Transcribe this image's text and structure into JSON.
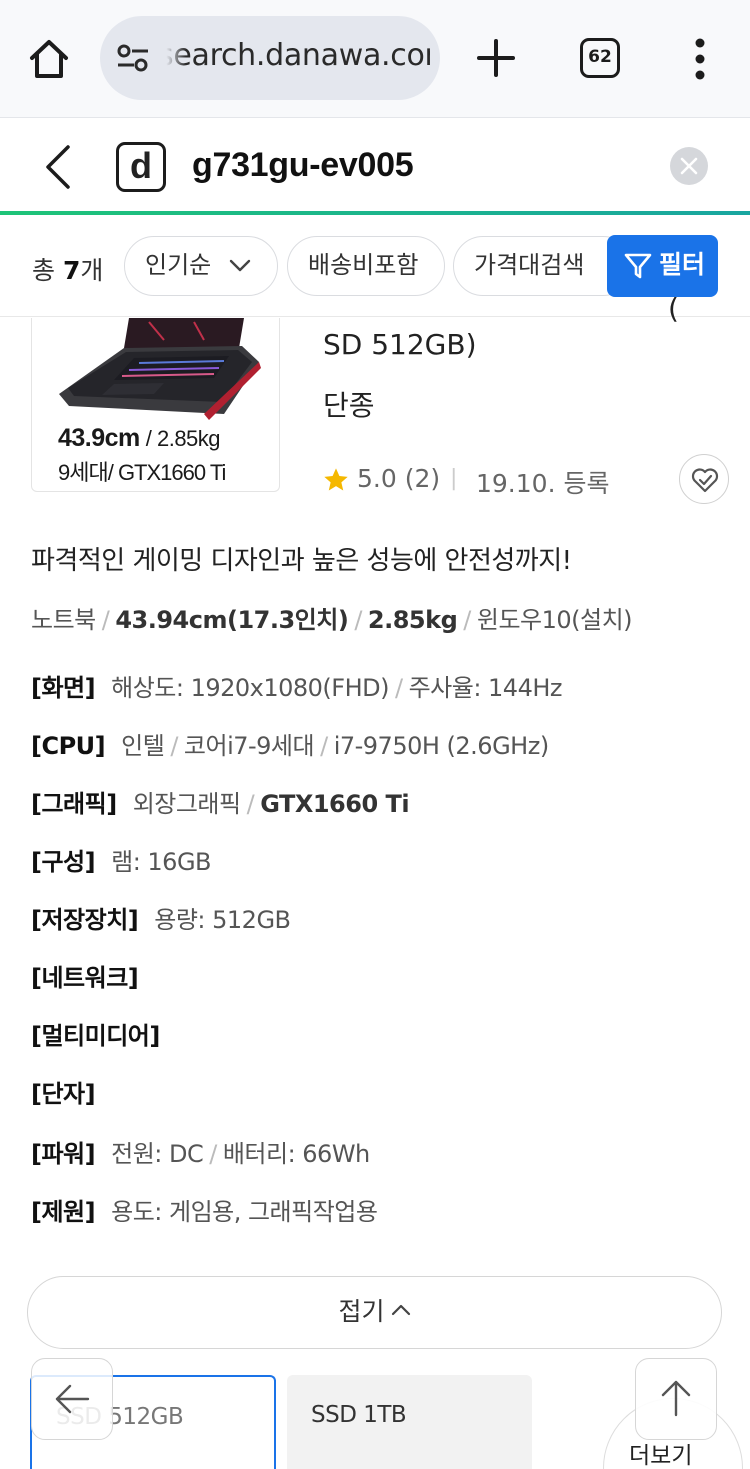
{
  "browser": {
    "url": "search.danawa.com",
    "tab_count": "62",
    "icons": [
      "home-icon",
      "site-settings-icon",
      "new-tab-icon",
      "tab-switcher-icon",
      "more-menu-icon"
    ]
  },
  "search": {
    "logo_letter": "d",
    "query": "g731gu-ev005",
    "accent_color": "#1ec478"
  },
  "filter_bar": {
    "total_prefix": "총",
    "total_count": "7",
    "total_suffix": "개",
    "sort_label": "인기순",
    "shipping_label": "배송비포함",
    "price_search_label": "가격대검색",
    "filter_label": "필터",
    "filter_color": "#1a73e8"
  },
  "product": {
    "image_caption": {
      "size": "43.9cm",
      "weight": "/ 2.85kg",
      "cpu_gen": "9세대",
      "gpu": "/ GTX1660 Ti"
    },
    "title_paren": "(",
    "title_fragment": "SD 512GB)",
    "status": "단종",
    "rating": "5.0",
    "review_count": "(2)",
    "reg_date": "19.10. 등록",
    "description": "파격적인 게이밍 디자인과 높은 성능에 안전성까지!",
    "summary": {
      "type": "노트북",
      "screen": "43.94cm(17.3인치)",
      "weight": "2.85kg",
      "os": "윈도우10(설치)"
    },
    "specs": {
      "display": {
        "label": "[화면]",
        "resolution": "해상도: 1920x1080(FHD)",
        "refresh": "주사율: 144Hz"
      },
      "cpu": {
        "label": "[CPU]",
        "maker": "인텔",
        "series": "코어i7-9세대",
        "model": "i7-9750H (2.6GHz)"
      },
      "graphics": {
        "label": "[그래픽]",
        "type": "외장그래픽",
        "model": "GTX1660 Ti"
      },
      "config": {
        "label": "[구성]",
        "ram": "램: 16GB"
      },
      "storage": {
        "label": "[저장장치]",
        "capacity": "용량: 512GB"
      },
      "network": {
        "label": "[네트워크]"
      },
      "multimedia": {
        "label": "[멀티미디어]"
      },
      "ports": {
        "label": "[단자]"
      },
      "power": {
        "label": "[파워]",
        "source": "전원: DC",
        "battery": "배터리: 66Wh"
      },
      "spec": {
        "label": "[제원]",
        "usage": "용도: 게임용, 그래픽작업용"
      }
    },
    "fold_label": "접기",
    "options": [
      "SSD 512GB",
      "SSD 1TB"
    ],
    "more_label": "더보기"
  }
}
